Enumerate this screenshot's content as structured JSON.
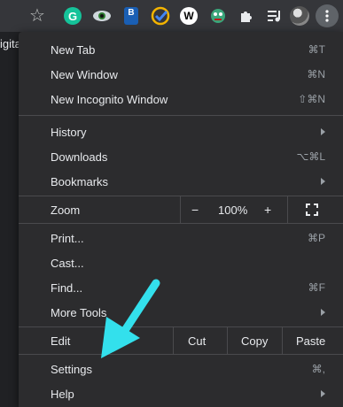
{
  "toolbar": {
    "icons": [
      "star-icon",
      "grammarly-icon",
      "eye-icon",
      "bookmark-ext-icon",
      "todo-check-icon",
      "wiki-icon",
      "mascot-icon",
      "puzzle-icon",
      "media-icon",
      "avatar",
      "kebab-menu-icon"
    ],
    "grammarly_letter": "G",
    "bext_letter": "B",
    "wiki_letter": "W"
  },
  "page": {
    "tab_text": "igital"
  },
  "menu": {
    "new_tab": {
      "label": "New Tab",
      "shortcut": "⌘T"
    },
    "new_window": {
      "label": "New Window",
      "shortcut": "⌘N"
    },
    "new_incognito": {
      "label": "New Incognito Window",
      "shortcut": "⇧⌘N"
    },
    "history": {
      "label": "History"
    },
    "downloads": {
      "label": "Downloads",
      "shortcut": "⌥⌘L"
    },
    "bookmarks": {
      "label": "Bookmarks"
    },
    "zoom": {
      "label": "Zoom",
      "minus": "−",
      "level": "100%",
      "plus": "+"
    },
    "print": {
      "label": "Print...",
      "shortcut": "⌘P"
    },
    "cast": {
      "label": "Cast..."
    },
    "find": {
      "label": "Find...",
      "shortcut": "⌘F"
    },
    "more_tools": {
      "label": "More Tools"
    },
    "edit": {
      "label": "Edit",
      "cut": "Cut",
      "copy": "Copy",
      "paste": "Paste"
    },
    "settings": {
      "label": "Settings",
      "shortcut": "⌘,"
    },
    "help": {
      "label": "Help"
    }
  },
  "colors": {
    "annotation_arrow": "#33e0ec",
    "menu_bg": "#2c2c2e",
    "toolbar_bg": "#35363a"
  }
}
